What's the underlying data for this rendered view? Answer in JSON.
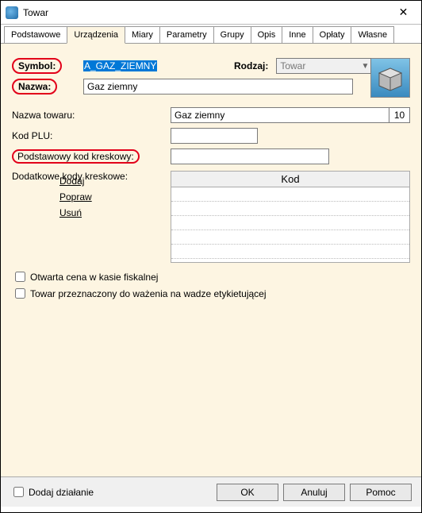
{
  "window": {
    "title": "Towar"
  },
  "tabs": {
    "items": [
      "Podstawowe",
      "Urządzenia",
      "Miary",
      "Parametry",
      "Grupy",
      "Opis",
      "Inne",
      "Opłaty",
      "Własne"
    ],
    "active_index": 1
  },
  "form": {
    "symbol_label": "Symbol:",
    "symbol_value": "A_GAZ_ZIEMNY",
    "rodzaj_label": "Rodzaj:",
    "rodzaj_value": "Towar",
    "nazwa_label": "Nazwa:",
    "nazwa_value": "Gaz ziemny",
    "nazwa_towaru_label": "Nazwa towaru:",
    "nazwa_towaru_value": "Gaz ziemny",
    "nazwa_towaru_count": "10",
    "kod_plu_label": "Kod PLU:",
    "kod_plu_value": "",
    "barcode_label": "Podstawowy kod kreskowy:",
    "barcode_value": "",
    "extra_barcodes_label": "Dodatkowe kody kreskowe:",
    "link_add": "Dodaj",
    "link_edit": "Popraw",
    "link_del": "Usuń",
    "table_header": "Kod",
    "chk_open_price": "Otwarta cena w kasie fiskalnej",
    "chk_weigh": "Towar przeznaczony do ważenia na wadze etykietującej"
  },
  "footer": {
    "add_action": "Dodaj działanie",
    "ok": "OK",
    "cancel": "Anuluj",
    "help": "Pomoc"
  }
}
